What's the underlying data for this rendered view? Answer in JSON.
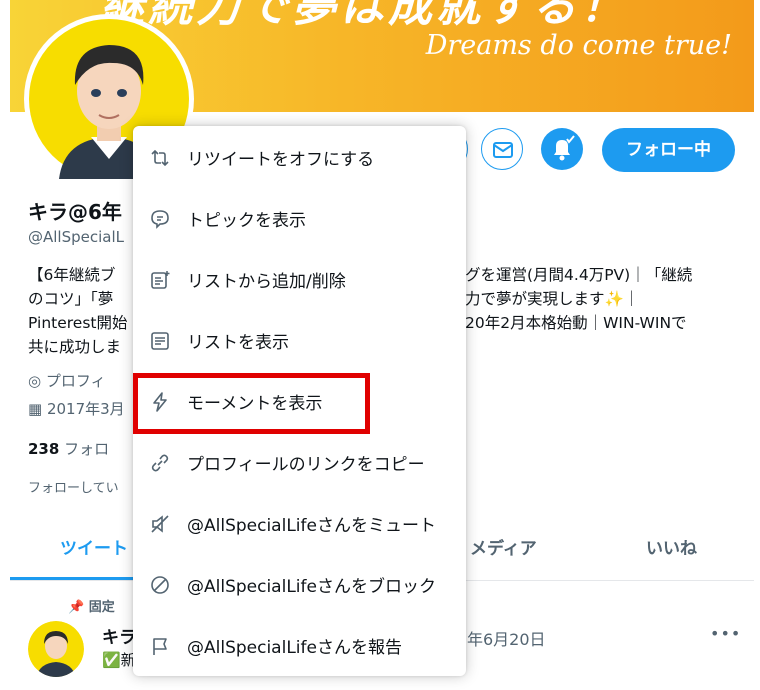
{
  "banner": {
    "line1": "継続力で夢は成就する！",
    "line2": "Dreams do come true!"
  },
  "profile": {
    "name": "キラ@6年",
    "handle": "@AllSpecialL",
    "bio_lines": [
      {
        "left": "【6年継続ブ",
        "right": "グを運営(月間4.4万PV)｜「継続"
      },
      {
        "left": "のコツ」「夢",
        "right": "力で夢が実現します✨｜"
      },
      {
        "left": "Pinterest開始",
        "right": "20年2月本格始動｜WIN-WINで"
      },
      {
        "left": "共に成功しま",
        "right": ""
      }
    ],
    "location": "プロフィ",
    "joined": "2017年3月",
    "following_count": "238",
    "following_label": "フォロ",
    "followed_by": "フォローしてい",
    "follow_button": "フォロー中"
  },
  "tabs": [
    {
      "label": "ツイート"
    },
    {
      "label": "メディア"
    },
    {
      "label": "いいね"
    }
  ],
  "tweet": {
    "pinned_label": "固定",
    "author": "キラ",
    "sub_text": "✅新",
    "date": "年6月20日",
    "more": "•••"
  },
  "menu": {
    "items": [
      {
        "label": "リツイートをオフにする",
        "icon": "retweet-icon"
      },
      {
        "label": "トピックを表示",
        "icon": "topic-icon"
      },
      {
        "label": "リストから追加/削除",
        "icon": "list-add-icon"
      },
      {
        "label": "リストを表示",
        "icon": "list-icon"
      },
      {
        "label": "モーメントを表示",
        "icon": "moment-icon"
      },
      {
        "label": "プロフィールのリンクをコピー",
        "icon": "link-icon"
      },
      {
        "label": "@AllSpecialLifeさんをミュート",
        "icon": "mute-icon"
      },
      {
        "label": "@AllSpecialLifeさんをブロック",
        "icon": "block-icon"
      },
      {
        "label": "@AllSpecialLifeさんを報告",
        "icon": "report-flag-icon"
      }
    ],
    "highlighted_item": "モーメントを表示"
  },
  "colors": {
    "accent": "#1d9bf0",
    "highlight": "#e00000",
    "avatar_bg": "#f7dd00"
  }
}
